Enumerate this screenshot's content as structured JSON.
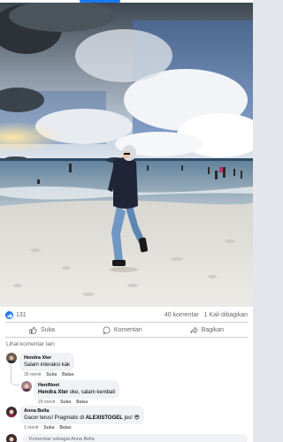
{
  "post": {
    "photo_alt": "Beach photo"
  },
  "stats": {
    "likes": "131",
    "comments": "40 komentar",
    "shares": "1 Kali dibagikan"
  },
  "actions": {
    "like": "Suka",
    "comment": "Komentari",
    "share": "Bagikan"
  },
  "view_more_comments": "Lihat komentar lain",
  "comments": [
    {
      "name": "Hendra Xter",
      "text": "Salam interaksi kak",
      "time": "30 menit",
      "like": "Suka",
      "reply": "Balas"
    },
    {
      "name": "HeniNoet",
      "text_name": "Hendra Xter",
      "text": " oke, salam kembali",
      "time": "29 menit",
      "like": "Suka",
      "reply": "Balas"
    },
    {
      "name": "Anna Bella",
      "text_pre": "Gacor terus! Pragmatic di ",
      "text_bold": "ALEXISTOGEL",
      "text_post": " jos! ",
      "emoji": "😎",
      "time": "1 menit",
      "like": "Suka",
      "reply": "Balas"
    }
  ],
  "composer": {
    "placeholder": "Komentari sebagai Anna Bella"
  },
  "colors": {
    "accent": "#1877f2",
    "muted": "#65676b",
    "bubble": "#f0f2f5"
  }
}
